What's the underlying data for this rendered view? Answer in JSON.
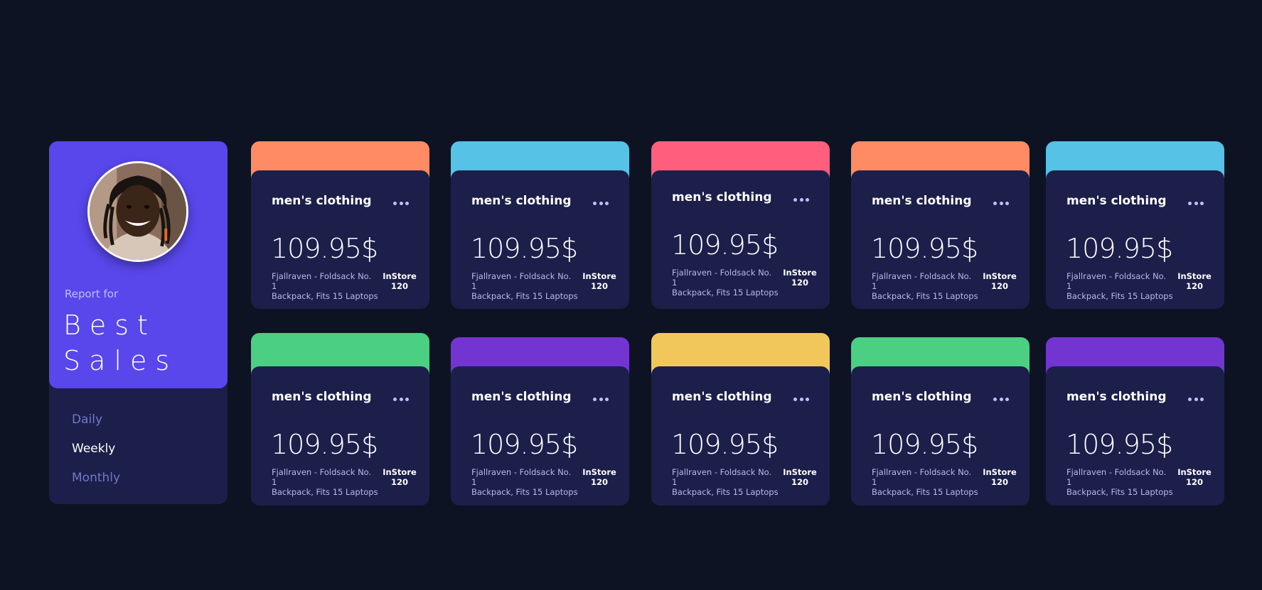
{
  "profile": {
    "report_label": "Report for",
    "title_line1": "Best",
    "title_line2": "Sales",
    "accent_color": "#5847eb",
    "periods": [
      {
        "label": "Daily",
        "active": false
      },
      {
        "label": "Weekly",
        "active": true
      },
      {
        "label": "Monthly",
        "active": false
      }
    ]
  },
  "menu_icon": "ellipsis-icon",
  "cards": [
    {
      "category": "men's clothing",
      "price": "109.95$",
      "desc_line1": "Fjallraven - Foldsack No. 1",
      "desc_line2": "Backpack, Fits 15 Laptops",
      "stock_label": "InStore",
      "stock_count": "120",
      "color": "#ff8b64"
    },
    {
      "category": "men's clothing",
      "price": "109.95$",
      "desc_line1": "Fjallraven - Foldsack No. 1",
      "desc_line2": "Backpack, Fits 15 Laptops",
      "stock_label": "InStore",
      "stock_count": "120",
      "color": "#55c2e6"
    },
    {
      "category": "men's clothing",
      "price": "109.95$",
      "desc_line1": "Fjallraven - Foldsack No. 1",
      "desc_line2": "Backpack, Fits 15 Laptops",
      "stock_label": "InStore",
      "stock_count": "120",
      "color": "#ff5e7d"
    },
    {
      "category": "men's clothing",
      "price": "109.95$",
      "desc_line1": "Fjallraven - Foldsack No. 1",
      "desc_line2": "Backpack, Fits 15 Laptops",
      "stock_label": "InStore",
      "stock_count": "120",
      "color": "#ff8b64"
    },
    {
      "category": "men's clothing",
      "price": "109.95$",
      "desc_line1": "Fjallraven - Foldsack No. 1",
      "desc_line2": "Backpack, Fits 15 Laptops",
      "stock_label": "InStore",
      "stock_count": "120",
      "color": "#55c2e6"
    },
    {
      "category": "men's clothing",
      "price": "109.95$",
      "desc_line1": "Fjallraven - Foldsack No. 1",
      "desc_line2": "Backpack, Fits 15 Laptops",
      "stock_label": "InStore",
      "stock_count": "120",
      "color": "#4bcf82"
    },
    {
      "category": "men's clothing",
      "price": "109.95$",
      "desc_line1": "Fjallraven - Foldsack No. 1",
      "desc_line2": "Backpack, Fits 15 Laptops",
      "stock_label": "InStore",
      "stock_count": "120",
      "color": "#7335d2"
    },
    {
      "category": "men's clothing",
      "price": "109.95$",
      "desc_line1": "Fjallraven - Foldsack No. 1",
      "desc_line2": "Backpack, Fits 15 Laptops",
      "stock_label": "InStore",
      "stock_count": "120",
      "color": "#f1c75b"
    },
    {
      "category": "men's clothing",
      "price": "109.95$",
      "desc_line1": "Fjallraven - Foldsack No. 1",
      "desc_line2": "Backpack, Fits 15 Laptops",
      "stock_label": "InStore",
      "stock_count": "120",
      "color": "#4bcf82"
    },
    {
      "category": "men's clothing",
      "price": "109.95$",
      "desc_line1": "Fjallraven - Foldsack No. 1",
      "desc_line2": "Backpack, Fits 15 Laptops",
      "stock_label": "InStore",
      "stock_count": "120",
      "color": "#7335d2"
    }
  ]
}
